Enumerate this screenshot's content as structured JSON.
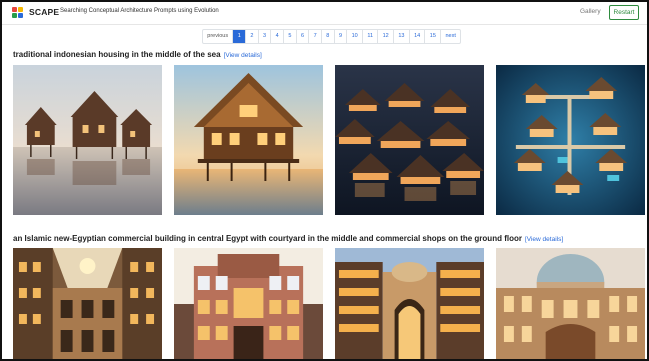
{
  "header": {
    "brand": "SCAPE",
    "tagline": "Searching Conceptual Architecture Prompts using Evolution",
    "gallery_label": "Gallery",
    "restart_label": "Restart"
  },
  "pagination": {
    "previous_label": "previous",
    "pages": [
      "1",
      "2",
      "3",
      "4",
      "5",
      "6",
      "7",
      "8",
      "9",
      "10",
      "11",
      "12",
      "13",
      "14",
      "15"
    ],
    "active_page": "1",
    "next_label": "next"
  },
  "prompts": [
    {
      "text": "traditional indonesian housing in the middle of the sea",
      "link_label": "[View details]",
      "images": [
        "stilt-house-reflection",
        "stilt-house-sunset",
        "floating-village-dusk",
        "water-village-aerial"
      ]
    },
    {
      "text": "an Islamic new-Egyptian commercial building in central Egypt with courtyard in the middle and commercial shops on the ground floor",
      "link_label": "[View details]",
      "images": [
        "courtyard-mall-sunlit",
        "ornate-facade-towers",
        "courtyard-arch-night",
        "domed-bazaar-atrium"
      ]
    }
  ],
  "colors": {
    "accent": "#2a6ad8",
    "restart": "#2e8b3e",
    "logo": [
      "#e8453c",
      "#f5b800",
      "#2a9d4a",
      "#2a6ad8"
    ]
  }
}
